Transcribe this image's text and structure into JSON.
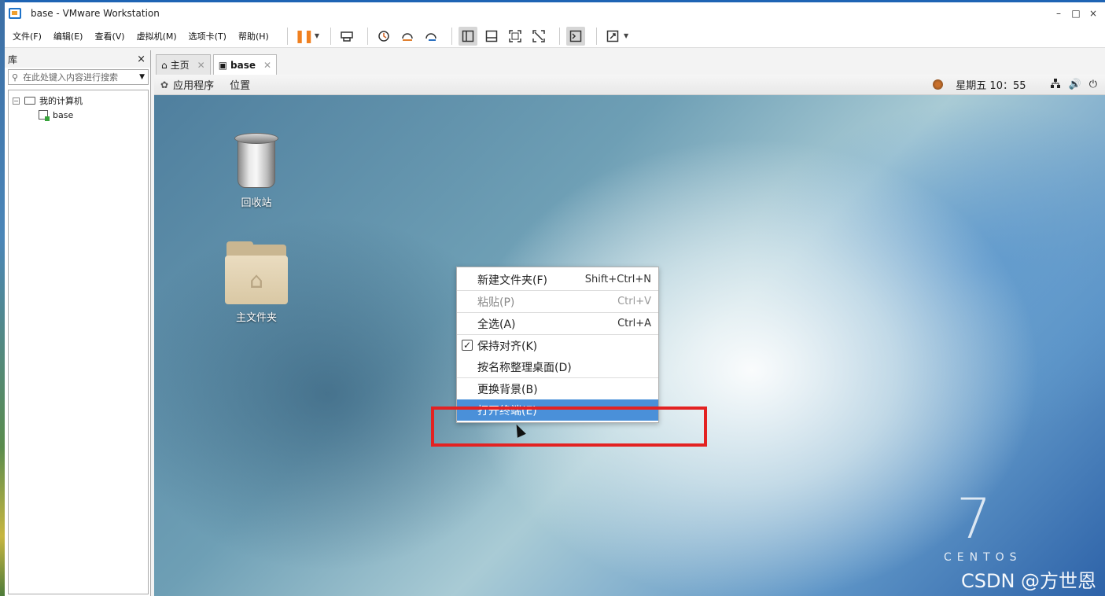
{
  "window": {
    "title": "base - VMware Workstation",
    "controls": [
      "–",
      "□",
      "×"
    ]
  },
  "menubar": {
    "items": [
      "文件(F)",
      "编辑(E)",
      "查看(V)",
      "虚拟机(M)",
      "选项卡(T)",
      "帮助(H)"
    ]
  },
  "library": {
    "title": "库",
    "close": "×",
    "search_placeholder": "在此处键入内容进行搜索",
    "tree": {
      "root_label": "我的计算机",
      "child_label": "base"
    }
  },
  "tabs": [
    {
      "label": "主页",
      "icon": "home-icon",
      "active": false
    },
    {
      "label": "base",
      "icon": "vm-icon",
      "active": true
    }
  ],
  "guest": {
    "topbar": {
      "apps_label": "应用程序",
      "places_label": "位置",
      "clock": "星期五 10：55"
    },
    "desktop_icons": [
      {
        "label": "回收站",
        "icon": "trash-icon"
      },
      {
        "label": "主文件夹",
        "icon": "home-folder-icon"
      }
    ],
    "context_menu": [
      {
        "label": "新建文件夹(F)",
        "shortcut": "Shift+Ctrl+N",
        "disabled": false
      },
      {
        "label": "粘贴(P)",
        "shortcut": "Ctrl+V",
        "disabled": true
      },
      {
        "label": "全选(A)",
        "shortcut": "Ctrl+A",
        "disabled": false
      },
      {
        "label": "保持对齐(K)",
        "shortcut": "",
        "checked": true
      },
      {
        "label": "按名称整理桌面(D)",
        "shortcut": ""
      },
      {
        "label": "更换背景(B)",
        "shortcut": ""
      },
      {
        "label": "打开终端(E)",
        "shortcut": "",
        "selected": true
      }
    ],
    "branding": {
      "version": "7",
      "name": "CENTOS"
    }
  },
  "watermark": "CSDN @方世恩",
  "colors": {
    "accent": "#1e64b4",
    "menu_selected": "#4a90d9",
    "highlight_box": "#e32222",
    "pause": "#f08020"
  }
}
